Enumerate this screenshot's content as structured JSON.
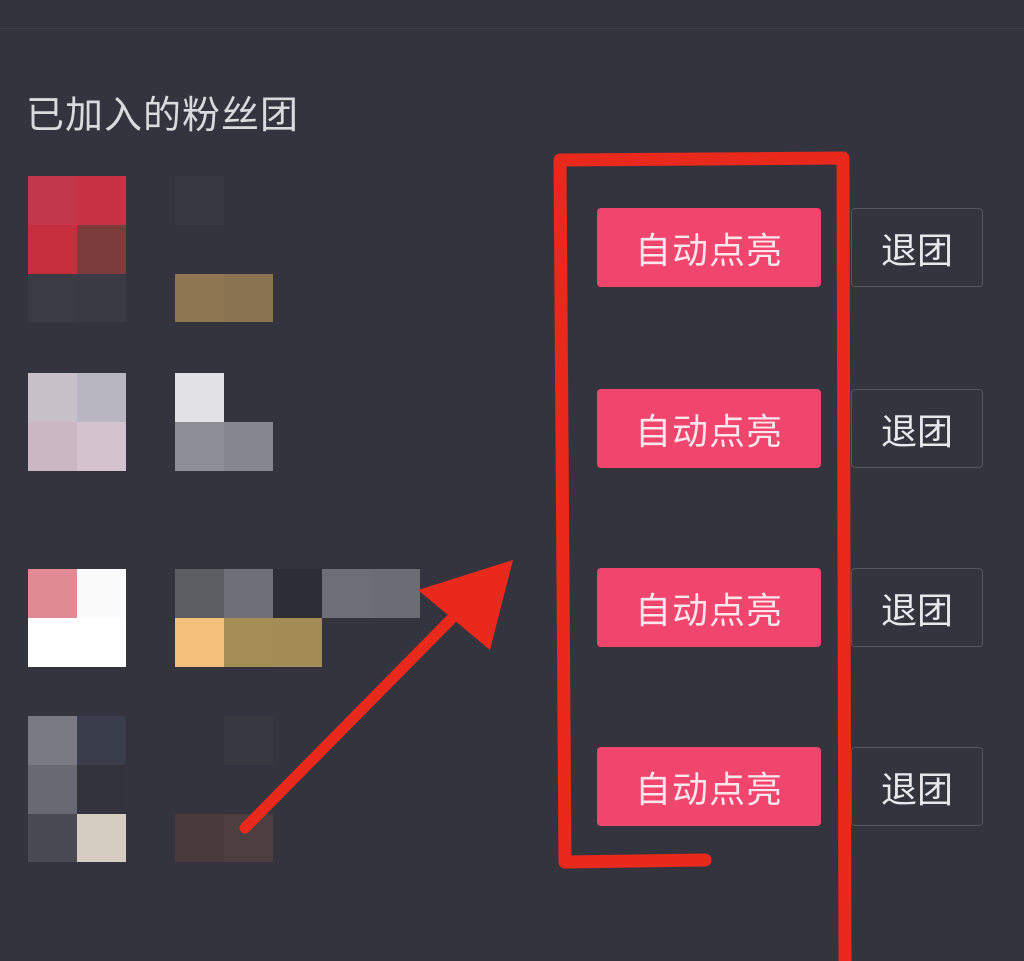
{
  "section": {
    "title": "已加入的粉丝团"
  },
  "rows": [
    {
      "light_label": "自动点亮",
      "quit_label": "退团"
    },
    {
      "light_label": "自动点亮",
      "quit_label": "退团"
    },
    {
      "light_label": "自动点亮",
      "quit_label": "退团"
    },
    {
      "light_label": "自动点亮",
      "quit_label": "退团"
    }
  ],
  "icons": {
    "avatar": "blurred-avatar-icon",
    "name": "blurred-name-text"
  },
  "colors": {
    "background": "#34343e",
    "accent": "#f0466d",
    "annotation": "#e8291c"
  }
}
